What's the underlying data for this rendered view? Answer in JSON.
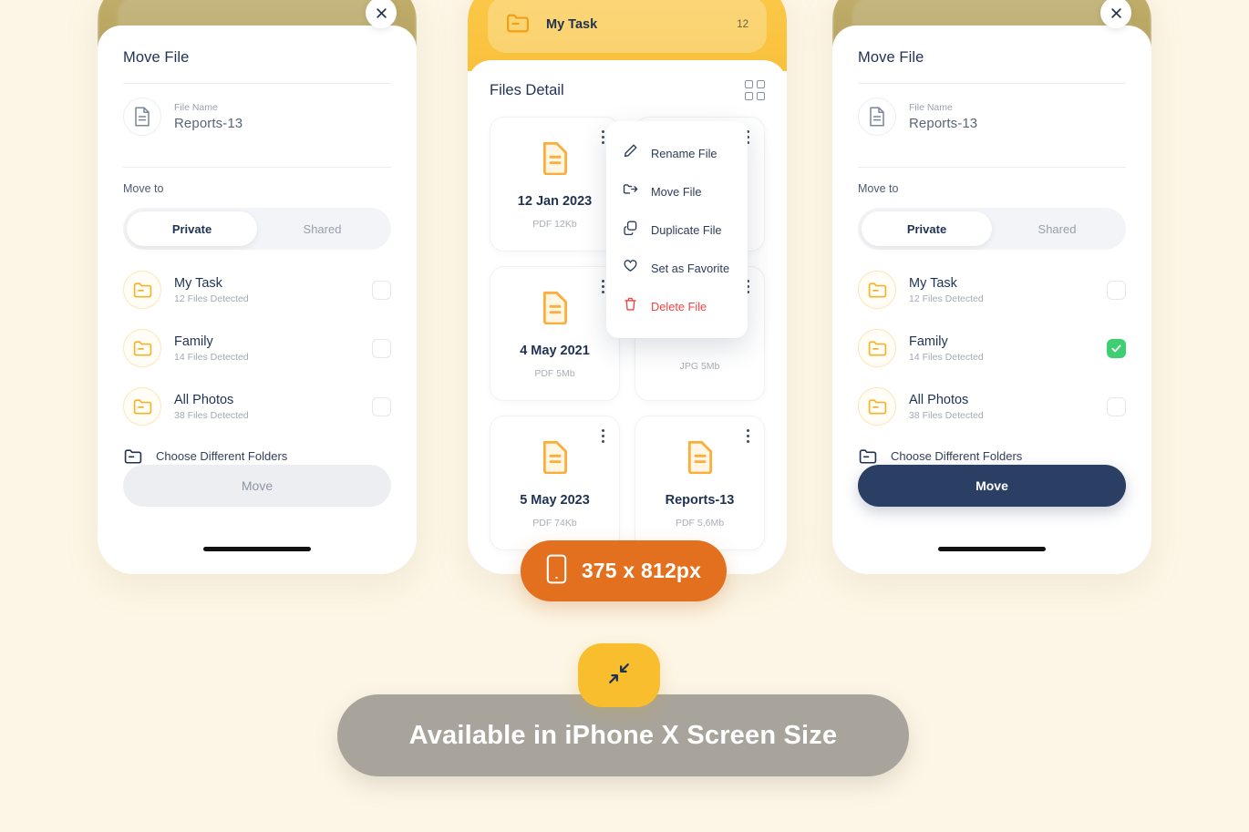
{
  "move_sheet": {
    "title": "Move File",
    "file_name_label": "File Name",
    "file_name_value": "Reports-13",
    "move_to_label": "Move to",
    "segments": [
      {
        "label": "Private",
        "active": true
      },
      {
        "label": "Shared",
        "active": false
      }
    ],
    "folders": [
      {
        "name": "My Task",
        "sub": "12 Files Detected",
        "checked": false
      },
      {
        "name": "Family",
        "sub": "14 Files Detected",
        "checked": false
      },
      {
        "name": "All Photos",
        "sub": "38 Files Detected",
        "checked": false
      }
    ],
    "folders_selected": [
      {
        "name": "My Task",
        "sub": "12 Files Detected",
        "checked": false
      },
      {
        "name": "Family",
        "sub": "14 Files Detected",
        "checked": true
      },
      {
        "name": "All Photos",
        "sub": "38 Files Detected",
        "checked": false
      }
    ],
    "choose_different": "Choose Different Folders",
    "move_button": "Move"
  },
  "files_detail": {
    "task_name": "My Task",
    "task_count": "12",
    "title": "Files Detail",
    "cards": [
      {
        "title": "12 Jan 2023",
        "sub": "PDF 12Kb"
      },
      {
        "title": "",
        "sub": ""
      },
      {
        "title": "4 May 2021",
        "sub": "PDF 5Mb"
      },
      {
        "title": "",
        "sub": "JPG 5Mb"
      },
      {
        "title": "5 May 2023",
        "sub": "PDF 74Kb"
      },
      {
        "title": "Reports-13",
        "sub": "PDF 5,6Mb"
      }
    ],
    "context_menu": [
      {
        "label": "Rename File",
        "icon": "pencil-icon",
        "danger": false
      },
      {
        "label": "Move File",
        "icon": "move-icon",
        "danger": false
      },
      {
        "label": "Duplicate File",
        "icon": "duplicate-icon",
        "danger": false
      },
      {
        "label": "Set as Favorite",
        "icon": "heart-icon",
        "danger": false
      },
      {
        "label": "Delete File",
        "icon": "trash-icon",
        "danger": true
      }
    ]
  },
  "badges": {
    "size": "375 x 812px",
    "availability": "Available in iPhone X Screen Size"
  },
  "colors": {
    "background": "#FDF6E6",
    "accent_yellow": "#F9C13C",
    "navy": "#2A3F63",
    "orange_badge": "#E3701E",
    "gray_badge": "#A9A49B",
    "green_check": "#3ECF72",
    "danger_red": "#EF4444"
  }
}
